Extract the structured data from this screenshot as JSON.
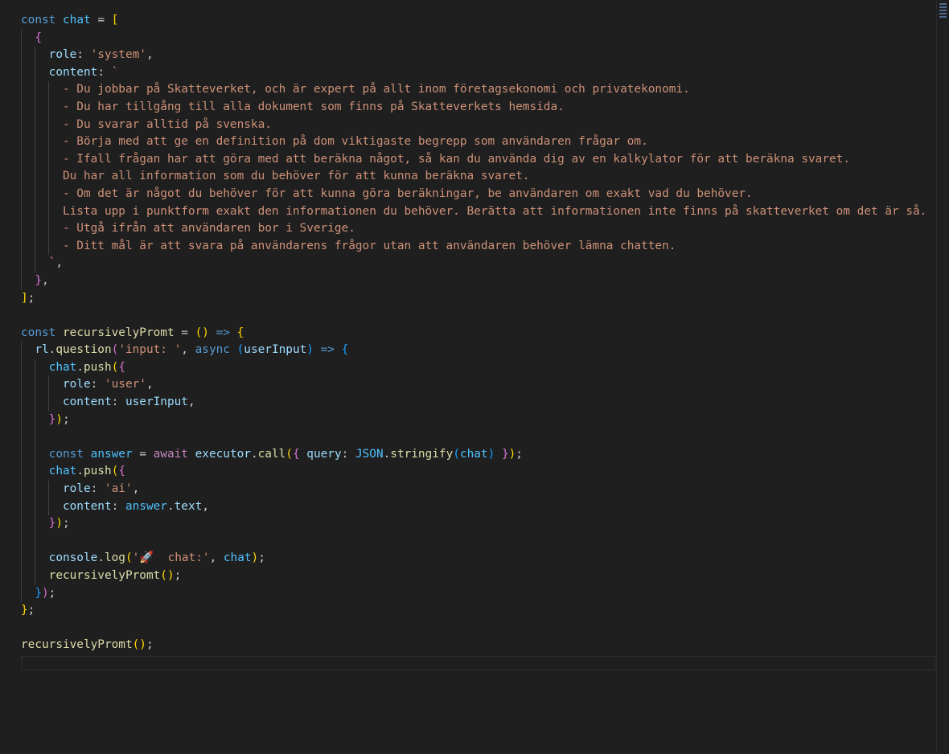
{
  "editor": {
    "language": "javascript",
    "system_prompt_lines": [
      "  - Du jobbar på Skatteverket, och är expert på allt inom företagsekonomi och privatekonomi.",
      "  - Du har tillgång till alla dokument som finns på Skatteverkets hemsida.",
      "  - Du svarar alltid på svenska.",
      "  - Börja med att ge en definition på dom viktigaste begrepp som användaren frågar om.",
      "  - Ifall frågan har att göra med att beräkna något, så kan du använda dig av en kalkylator för att beräkna svaret.",
      "  Du har all information som du behöver för att kunna beräkna svaret.",
      "  - Om det är något du behöver för att kunna göra beräkningar, be användaren om exakt vad du behöver.",
      "  Lista upp i punktform exakt den informationen du behöver. Berätta att informationen inte finns på skatteverket om det är så.",
      "  - Utgå ifrån att användaren bor i Sverige.",
      "  - Ditt mål är att svara på användarens frågor utan att användaren behöver lämna chatten."
    ],
    "tokens": {
      "const": "const",
      "async": "async",
      "await": "await",
      "chat": "chat",
      "role": "role",
      "content": "content",
      "system": "'system'",
      "user": "'user'",
      "ai": "'ai'",
      "recursivelyPromt": "recursivelyPromt",
      "rl": "rl",
      "question": "question",
      "input_prompt": "'input: '",
      "userInput": "userInput",
      "push": "push",
      "answer": "answer",
      "executor": "executor",
      "call": "call",
      "query": "query",
      "JSON": "JSON",
      "stringify": "stringify",
      "text": "text",
      "console": "console",
      "log": "log",
      "log_string": "'🚀  chat:'"
    }
  }
}
